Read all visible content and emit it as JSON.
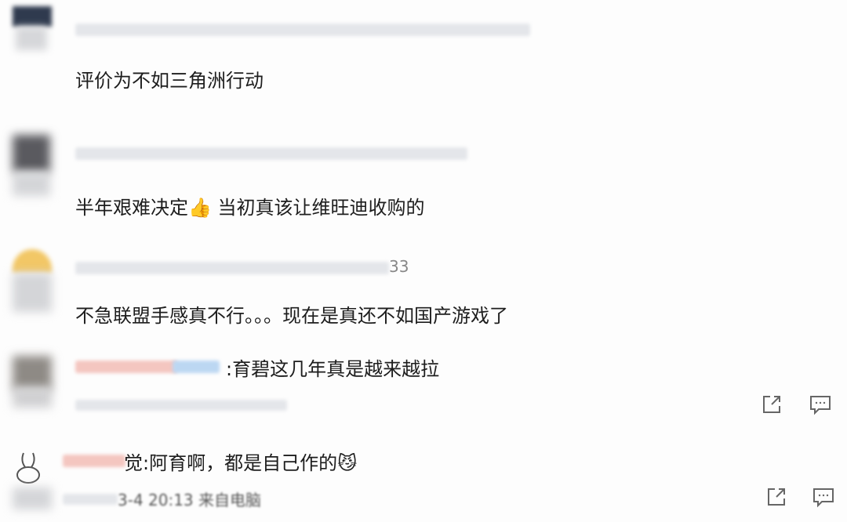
{
  "comments": [
    {
      "text": "评价为不如三角洲行动"
    },
    {
      "text_before": "半年艰难决定",
      "emoji": "👍",
      "text_after": " 当初真该让维旺迪收购的"
    },
    {
      "username_suffix": "33",
      "text": "不急联盟手感真不行。。。现在是真还不如国产游戏了"
    },
    {
      "text": ":育碧这几年真是越来越拉"
    },
    {
      "text": "觉:阿育啊，都是自己作的",
      "emoji": "😼",
      "meta": "3-4 20:13 来自电脑"
    }
  ],
  "icons": {
    "share": "share-icon",
    "reply": "comment-icon"
  },
  "colors": {
    "background": "#fdfdfd",
    "text": "#1d1d1d",
    "icon": "#666666"
  }
}
